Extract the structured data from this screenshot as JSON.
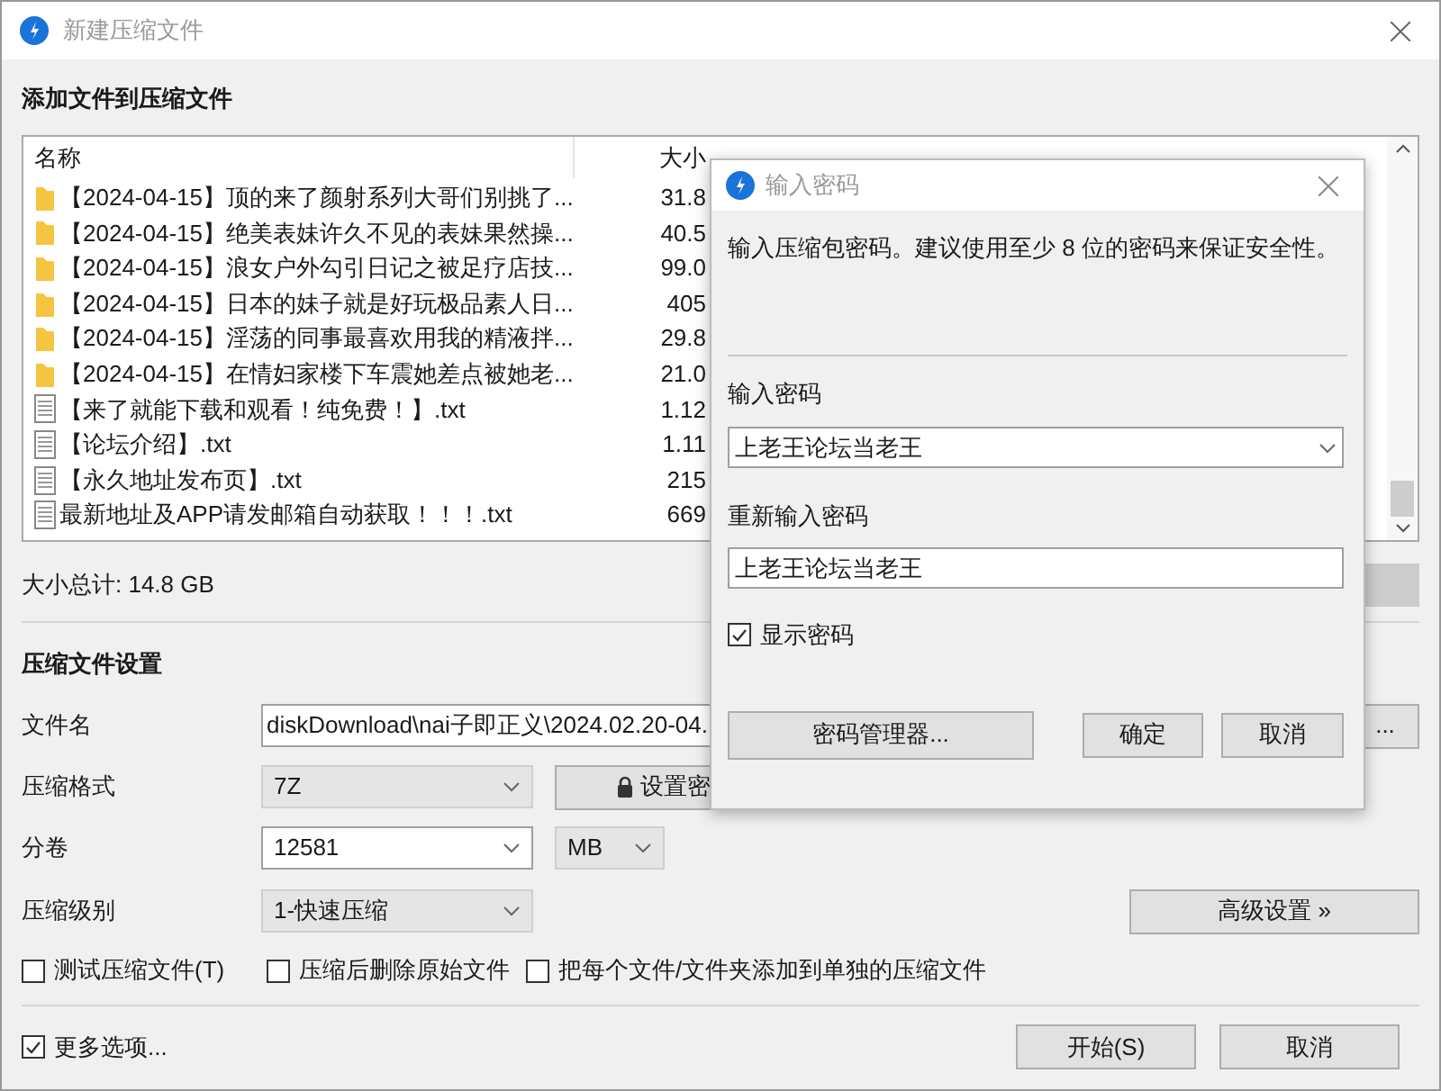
{
  "window": {
    "title": "新建压缩文件"
  },
  "files_section": {
    "heading": "添加文件到压缩文件",
    "columns": [
      "名称",
      "大小"
    ],
    "rows": [
      {
        "kind": "folder",
        "name": "【2024-04-15】顶的来了颜射系列大哥们别挑了...",
        "size": "31.8"
      },
      {
        "kind": "folder",
        "name": "【2024-04-15】绝美表妹许久不见的表妹果然操...",
        "size": "40.5"
      },
      {
        "kind": "folder",
        "name": "【2024-04-15】浪女户外勾引日记之被足疗店技...",
        "size": "99.0"
      },
      {
        "kind": "folder",
        "name": "【2024-04-15】日本的妹子就是好玩极品素人日...",
        "size": "405"
      },
      {
        "kind": "folder",
        "name": "【2024-04-15】淫荡的同事最喜欢用我的精液拌...",
        "size": "29.8"
      },
      {
        "kind": "folder",
        "name": "【2024-04-15】在情妇家楼下车震她差点被她老...",
        "size": "21.0"
      },
      {
        "kind": "file",
        "name": "【来了就能下载和观看！纯免费！】.txt",
        "size": "1.12"
      },
      {
        "kind": "file",
        "name": "【论坛介绍】.txt",
        "size": "1.11"
      },
      {
        "kind": "file",
        "name": "【永久地址发布页】.txt",
        "size": "215"
      },
      {
        "kind": "file",
        "name": "最新地址及APP请发邮箱自动获取！！！.txt",
        "size": "669"
      }
    ],
    "total": "大小总计: 14.8 GB"
  },
  "settings": {
    "heading": "压缩文件设置",
    "filename": {
      "label": "文件名",
      "value": "diskDownload\\nai子即正义\\2024.02.20-04."
    },
    "browse_button": "...",
    "format": {
      "label": "压缩格式",
      "value": "7Z",
      "disabled": true
    },
    "password_button": "设置密",
    "split": {
      "label": "分卷",
      "value": "12581",
      "disabled": false,
      "unit": "MB"
    },
    "level": {
      "label": "压缩级别",
      "value": "1-快速压缩",
      "disabled": true
    },
    "advanced_button": "高级设置 »"
  },
  "options": [
    {
      "label": "测试压缩文件(T)",
      "checked": false
    },
    {
      "label": "压缩后删除原始文件",
      "checked": false
    },
    {
      "label": "把每个文件/文件夹添加到单独的压缩文件",
      "checked": false
    }
  ],
  "more_options": {
    "label": "更多选项...",
    "checked": true
  },
  "buttons": [
    "开始(S)",
    "取消"
  ],
  "password_dialog": {
    "title": "输入密码",
    "description": "输入压缩包密码。建议使用至少 8 位的密码来保证安全性。",
    "password_label": "输入密码",
    "password_value": "上老王论坛当老王",
    "confirm_label": "重新输入密码",
    "confirm_value": "上老王论坛当老王",
    "show_password": {
      "label": "显示密码",
      "checked": true
    },
    "buttons": [
      "密码管理器...",
      "确定",
      "取消"
    ]
  }
}
